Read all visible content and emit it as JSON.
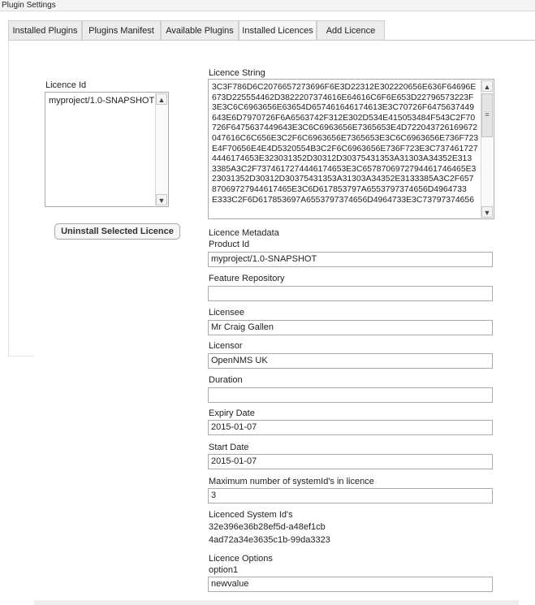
{
  "window": {
    "title": "Plugin Settings"
  },
  "tabs": [
    {
      "label": "Installed Plugins",
      "active": false
    },
    {
      "label": "Plugins Manifest",
      "active": false
    },
    {
      "label": "Available Plugins",
      "active": false
    },
    {
      "label": "Installed Licences",
      "active": true
    },
    {
      "label": "Add Licence",
      "active": false
    }
  ],
  "licence_id": {
    "label": "Licence Id",
    "items": [
      "myproject/1.0-SNAPSHOT"
    ]
  },
  "uninstall_button": {
    "label": "Uninstall Selected Licence"
  },
  "licence_string": {
    "label": "Licence String",
    "lines": [
      "3C3F786D6C2076657273696F6E3D22312E302220656E636F64696E",
      "673D225554462D3822207374616E64616C6F6E653D22796573223F",
      "3E3C6C6963656E63654D657461646174613E3C70726F6475637449",
      "643E6D7970726F6A6563742F312E302D534E415053484F543C2F70",
      "726F6475637449643E3C6C6963656E7365653E4D722043726169672",
      "047616C6C656E3C2F6C6963656E7365653E3C6C6963656E736F723",
      "E4F70656E4E4D5320554B3C2F6C6963656E736F723E3C737461727",
      "4446174653E323031352D30312D30375431353A31303A34352E313",
      "3385A3C2F7374617274446174653E3C6578706972794461746465E3",
      "23031352D30312D30375431353A31303A34352E3133385A3C2F657",
      "87069727944617465E3C6D617853797A6553797374656D4964733",
      "E333C2F6D617853697A6553797374656D4964733E3C73797374656"
    ]
  },
  "metadata": {
    "heading": "Licence Metadata",
    "product_id": {
      "label": "Product Id",
      "value": "myproject/1.0-SNAPSHOT"
    },
    "feature_repository": {
      "label": "Feature Repository",
      "value": ""
    },
    "licensee": {
      "label": "Licensee",
      "value": "Mr Craig Gallen"
    },
    "licensor": {
      "label": "Licensor",
      "value": "OpenNMS UK"
    },
    "duration": {
      "label": "Duration",
      "value": ""
    },
    "expiry_date": {
      "label": "Expiry Date",
      "value": "2015-01-07"
    },
    "start_date": {
      "label": "Start Date",
      "value": "2015-01-07"
    },
    "max_system_ids": {
      "label": "Maximum number of systemId's in licence",
      "value": "3"
    },
    "licenced_system_ids": {
      "label": "Licenced System Id's",
      "values": [
        "32e396e36b28ef5d-a48ef1cb",
        "4ad72a34e3635c1b-99da3323"
      ]
    },
    "licence_options": {
      "label": "Licence Options",
      "option_name": "option1",
      "option_value": "newvalue"
    }
  }
}
